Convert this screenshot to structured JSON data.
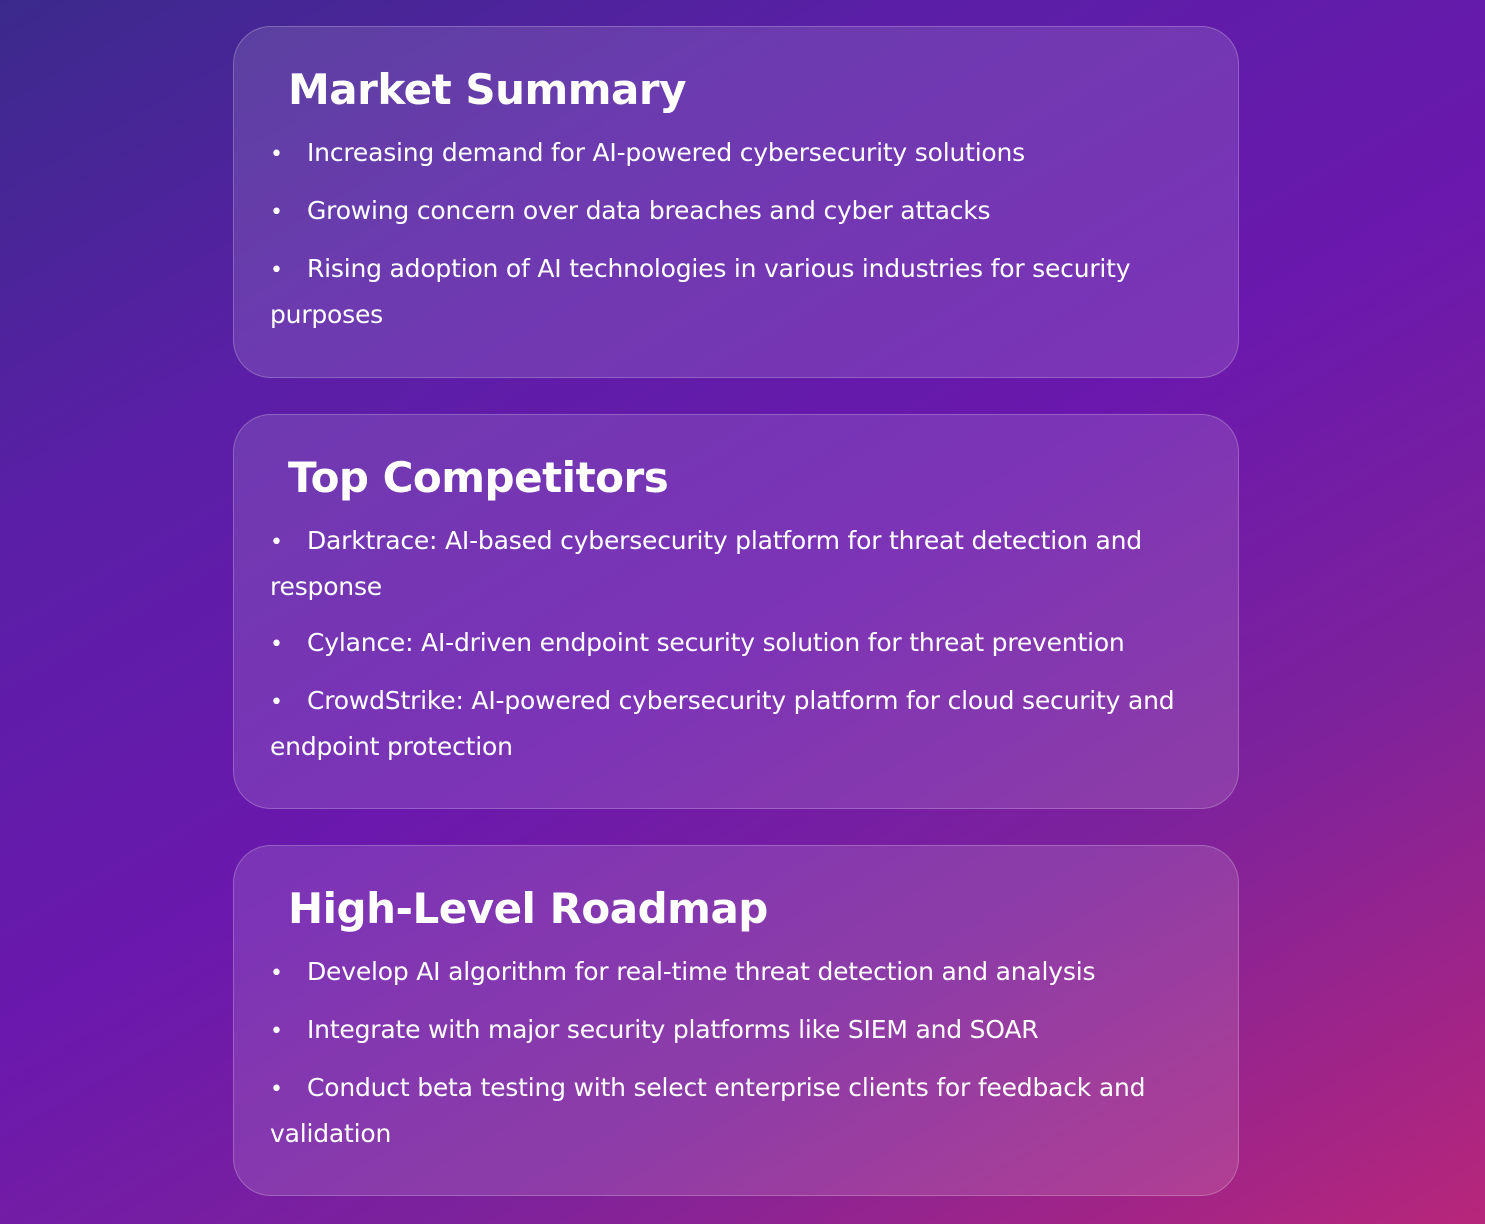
{
  "sections": [
    {
      "title": "Market Summary",
      "items": [
        "Increasing demand for AI-powered cybersecurity solutions",
        "Growing concern over data breaches and cyber attacks",
        "Rising adoption of AI technologies in various industries for security purposes"
      ]
    },
    {
      "title": "Top Competitors",
      "items": [
        "Darktrace: AI-based cybersecurity platform for threat detection and response",
        "Cylance: AI-driven endpoint security solution for threat prevention",
        "CrowdStrike: AI-powered cybersecurity platform for cloud security and endpoint protection"
      ]
    },
    {
      "title": "High-Level Roadmap",
      "items": [
        "Develop AI algorithm for real-time threat detection and analysis",
        "Integrate with major security platforms like SIEM and SOAR",
        "Conduct beta testing with select enterprise clients for feedback and validation"
      ]
    }
  ],
  "bullet_glyph": "•"
}
